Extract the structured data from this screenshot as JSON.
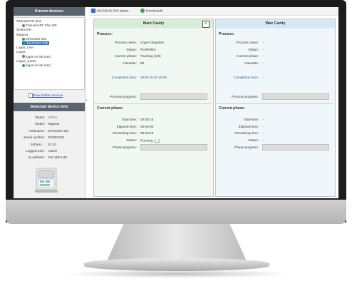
{
  "sidebar": {
    "known_devices_title": "Known devices",
    "tree": [
      {
        "label": "TissueSAFE plus",
        "indent": 0,
        "dot": false,
        "selected": false
      },
      {
        "label": "TissueSAFE Plus OR",
        "indent": 2,
        "dot": true,
        "selected": false
      },
      {
        "label": "SealSAFE",
        "indent": 0,
        "dot": false,
        "selected": false
      },
      {
        "label": "Magnus",
        "indent": 0,
        "dot": false,
        "selected": false
      },
      {
        "label": "MAGNUS 003",
        "indent": 2,
        "dot": true,
        "selected": false
      },
      {
        "label": "MAGNUS 036",
        "indent": 2,
        "dot": true,
        "selected": true
      },
      {
        "label": "Logos_One",
        "indent": 0,
        "dot": false,
        "selected": false
      },
      {
        "label": "Logos",
        "indent": 0,
        "dot": false,
        "selected": false
      },
      {
        "label": "logos ce lab med",
        "indent": 2,
        "dot": true,
        "selected": false
      },
      {
        "label": "Logos_Junior",
        "indent": 0,
        "dot": false,
        "selected": false
      },
      {
        "label": "logos ce lab med",
        "indent": 2,
        "dot": true,
        "selected": false
      }
    ],
    "show_hidden_label": "Show hidden devices",
    "selected_info_title": "Selected device info",
    "info": [
      {
        "label": "Status:",
        "value": "Online",
        "color": "#2a9a2a"
      },
      {
        "label": "Model:",
        "value": "Magnus",
        "color": "#333333"
      },
      {
        "label": "Nickname:",
        "value": "MAGNUS 036",
        "color": "#333333"
      },
      {
        "label": "Serial number:",
        "value": "202301036",
        "color": "#333333"
      },
      {
        "label": "Softwar...:",
        "value": "20.10",
        "color": "#333333"
      },
      {
        "label": "Logged user:",
        "value": "Admin",
        "color": "#333333"
      },
      {
        "label": "Ip address:",
        "value": "192.168.5.68",
        "color": "#333333"
      }
    ]
  },
  "tabs": [
    {
      "label": "MAGNUS 036 status",
      "icon": "monitor-icon",
      "color": "#2b6fc5"
    },
    {
      "label": "Downloads",
      "icon": "download-icon",
      "color": "#3aa43a"
    }
  ],
  "main_cavity": {
    "title": "Main Cavity",
    "menu_icon": "≡",
    "process_title": "Process:",
    "process_rows": [
      {
        "label": "Process name:",
        "value": "Urgent Biopsies"
      },
      {
        "label": "Status:",
        "value": "RUNNING"
      },
      {
        "label": "Current phase:",
        "value": "Flushing (1/9)"
      },
      {
        "label": "Cassette:",
        "value": "50"
      }
    ],
    "completion_label": "Completion time:",
    "completion_value": "2020-10-26 16:00",
    "process_progress_label": "Process progress:",
    "process_progress": 0.0,
    "phase_title": "Current phase:",
    "phase_rows": [
      {
        "label": "Total time:",
        "value": "00:00:15"
      },
      {
        "label": "Elapsed time:",
        "value": "00:00:00"
      },
      {
        "label": "Remaining time:",
        "value": "00:00:15"
      },
      {
        "label": "Status:",
        "value": "Running"
      }
    ],
    "phase_progress_label": "Phase progress:",
    "phase_progress": 0.0
  },
  "wax_cavity": {
    "title": "Wax Cavity",
    "process_title": "Process:",
    "process_rows": [
      {
        "label": "Process name:",
        "value": "-"
      },
      {
        "label": "Status:",
        "value": "-"
      },
      {
        "label": "Current phase:",
        "value": "-"
      },
      {
        "label": "Cassette:",
        "value": "-"
      }
    ],
    "completion_label": "Completion time:",
    "completion_value": "-",
    "process_progress_label": "Process progress:",
    "process_progress": 0.0,
    "phase_title": "Current phase:",
    "phase_rows": [
      {
        "label": "Total time:",
        "value": "-"
      },
      {
        "label": "Elapsed time:",
        "value": "-"
      },
      {
        "label": "Remaining time:",
        "value": "-"
      },
      {
        "label": "Status:",
        "value": "-"
      }
    ],
    "phase_progress_label": "Phase progress:",
    "phase_progress": 0.0
  },
  "collapse_glyph": "«"
}
